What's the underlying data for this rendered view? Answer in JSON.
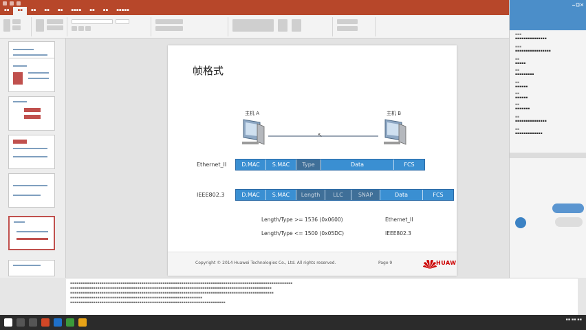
{
  "slide": {
    "title": "帧格式",
    "host_a": "主机 A",
    "host_b": "主机 B",
    "ethernet_label": "Ethernet_II",
    "ethernet_fields": [
      "D.MAC",
      "S.MAC",
      "Type",
      "Data",
      "FCS"
    ],
    "ieee_label": "IEEE802.3",
    "ieee_fields": [
      "D.MAC",
      "S.MAC",
      "Length",
      "LLC",
      "SNAP",
      "Data",
      "FCS"
    ],
    "rule1": "Length/Type >= 1536 (0x0600)",
    "rule1_result": "Ethernet_II",
    "rule2": "Length/Type <= 1500 (0x05DC)",
    "rule2_result": "IEEE802.3",
    "copyright": "Copyright © 2014 Huawei Technologies Co., Ltd. All rights reserved.",
    "page": "Page 9",
    "brand": "HUAWEI"
  },
  "colors": {
    "accent": "#b7472a",
    "frame_field": "#3a8fd2",
    "frame_field_dark": "#3f6f98",
    "huawei_red": "#cc0000"
  }
}
